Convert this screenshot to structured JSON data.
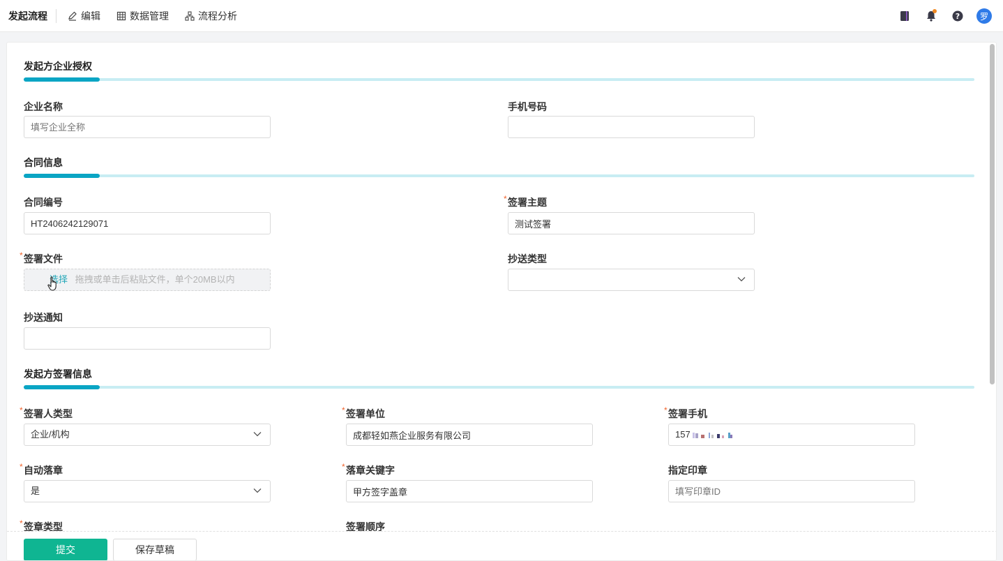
{
  "header": {
    "title": "发起流程",
    "nav": [
      {
        "label": "编辑",
        "icon": "edit-icon"
      },
      {
        "label": "数据管理",
        "icon": "table-icon"
      },
      {
        "label": "流程分析",
        "icon": "flow-chart-icon"
      }
    ],
    "icons": [
      "notebook-icon",
      "bell-icon",
      "help-icon"
    ],
    "avatar_text": "罗"
  },
  "sections": {
    "auth": {
      "title": "发起方企业授权",
      "company_name": {
        "label": "企业名称",
        "value": "",
        "placeholder": "填写企业全称"
      },
      "phone": {
        "label": "手机号码",
        "value": ""
      }
    },
    "contract": {
      "title": "合同信息",
      "number": {
        "label": "合同编号",
        "value": "HT2406242129071"
      },
      "subject": {
        "label": "签署主题",
        "required": "*",
        "value": "测试签署"
      },
      "file": {
        "label": "签署文件",
        "required": "*",
        "link": "选择",
        "hint": "拖拽或单击后粘贴文件，单个20MB以内"
      },
      "cc_type": {
        "label": "抄送类型",
        "value": ""
      },
      "cc_notice": {
        "label": "抄送通知",
        "value": ""
      }
    },
    "signer": {
      "title": "发起方签署信息",
      "signer_type": {
        "label": "签署人类型",
        "required": "*",
        "value": "企业/机构"
      },
      "sign_unit": {
        "label": "签署单位",
        "required": "*",
        "value": "成都轻如燕企业服务有限公司"
      },
      "sign_phone": {
        "label": "签署手机",
        "required": "*",
        "value": "157"
      },
      "auto_seal": {
        "label": "自动落章",
        "required": "*",
        "value": "是"
      },
      "seal_keyword": {
        "label": "落章关键字",
        "required": "*",
        "value": "甲方签字盖章"
      },
      "seal_id": {
        "label": "指定印章",
        "placeholder": "填写印章ID"
      },
      "seal_type": {
        "label": "签章类型",
        "required": "*"
      },
      "sign_order": {
        "label": "签署顺序"
      }
    }
  },
  "footer": {
    "submit_label": "提交",
    "draft_label": "保存草稿"
  },
  "colors": {
    "accent": "#0aa5c4",
    "primary_button": "#0fb592",
    "required_mark": "#f0642d",
    "upload_link": "#22a7b8"
  }
}
